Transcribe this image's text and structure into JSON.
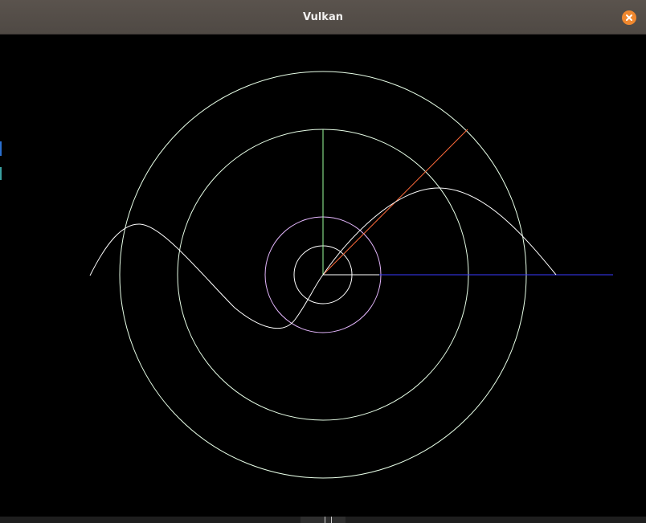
{
  "window": {
    "title": "Vulkan",
    "close_icon": "close-icon",
    "accent_color": "#f0882f"
  },
  "scene": {
    "background": "#000000",
    "line_colors": {
      "circles": "#ffffff",
      "inner_circle": "#e0b0ff",
      "vertical_line": "#80ff80",
      "diagonal_line": "#ff7030",
      "horizontal_line": "#3030ff",
      "sine_wave": "#ffffff"
    }
  }
}
